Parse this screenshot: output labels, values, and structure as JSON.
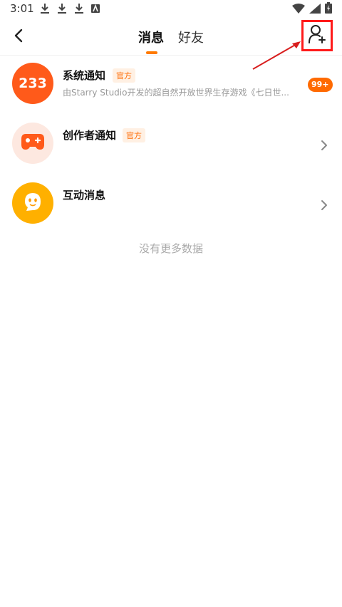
{
  "status_bar": {
    "time": "3:01"
  },
  "header": {
    "tabs": [
      {
        "label": "消息",
        "active": true
      },
      {
        "label": "好友",
        "active": false
      }
    ]
  },
  "messages": [
    {
      "title": "系统通知",
      "badge": "官方",
      "avatar_text": "233",
      "subtitle": "由Starry Studio开发的超自然开放世界生存游戏《七日世...",
      "count": "99+"
    },
    {
      "title": "创作者通知",
      "badge": "官方",
      "subtitle": "",
      "icon": "gamepad-icon"
    },
    {
      "title": "互动消息",
      "subtitle": "",
      "icon": "chat-face-icon"
    }
  ],
  "footer": {
    "no_more_text": "没有更多数据"
  },
  "colors": {
    "accent": "#ff7a00",
    "badge_text": "#ff6a00",
    "annotation": "#ff1a1a"
  }
}
